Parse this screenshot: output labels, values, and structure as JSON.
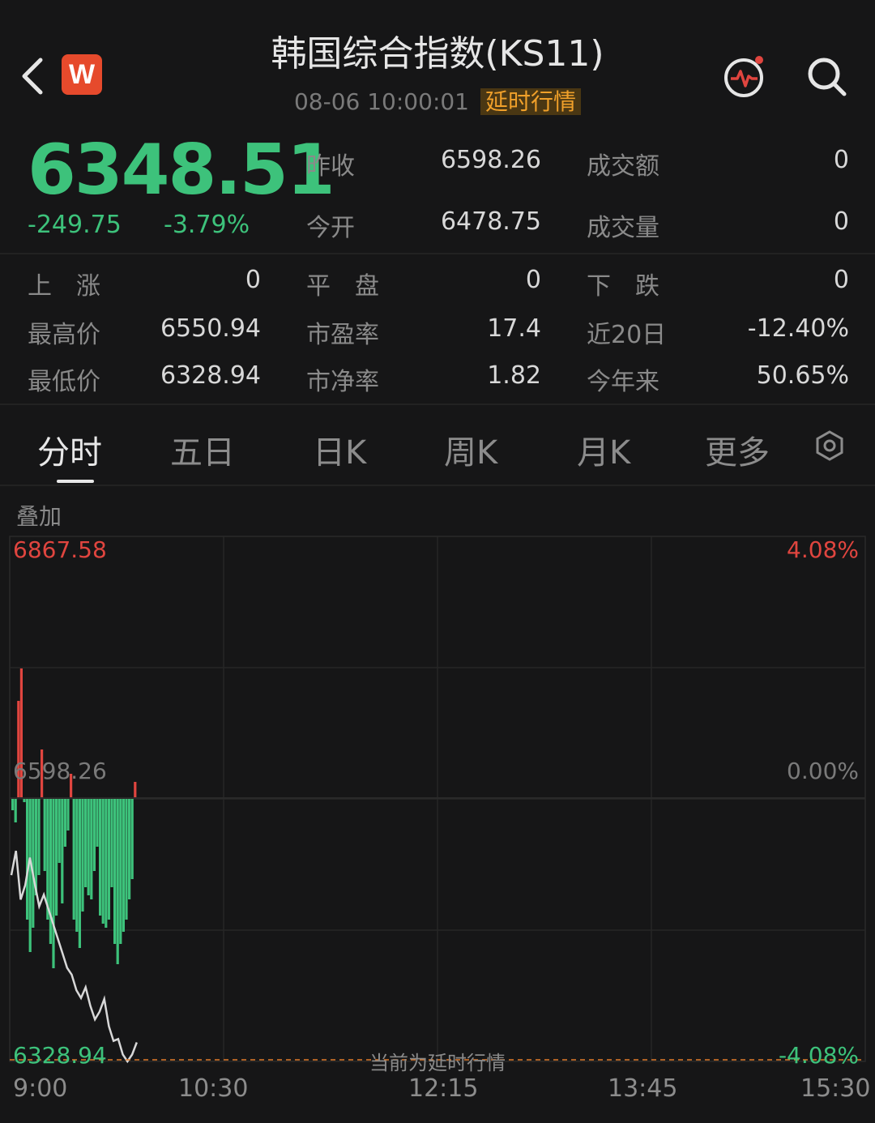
{
  "header": {
    "back_icon": "chevron-left-icon",
    "app_logo_text": "W",
    "title": "韩国综合指数(KS11)",
    "datetime": "08-06 10:00:01",
    "delay_badge": "延时行情",
    "pulse_icon": "pulse-alert-icon",
    "search_icon": "search-icon"
  },
  "quote": {
    "price": "6348.51",
    "change": "-249.75",
    "change_pct": "-3.79%",
    "fields": [
      {
        "label": "昨收",
        "value": "6598.26"
      },
      {
        "label": "成交额",
        "value": "0"
      },
      {
        "label": "今开",
        "value": "6478.75"
      },
      {
        "label": "成交量",
        "value": "0"
      }
    ]
  },
  "stats": [
    {
      "label": "上　涨",
      "value": "0"
    },
    {
      "label": "平　盘",
      "value": "0"
    },
    {
      "label": "下　跌",
      "value": "0"
    },
    {
      "label": "最高价",
      "value": "6550.94"
    },
    {
      "label": "市盈率",
      "value": "17.4"
    },
    {
      "label": "近20日",
      "value": "-12.40%"
    },
    {
      "label": "最低价",
      "value": "6328.94"
    },
    {
      "label": "市净率",
      "value": "1.82"
    },
    {
      "label": "今年来",
      "value": "50.65%"
    }
  ],
  "tabs": [
    "分时",
    "五日",
    "日K",
    "周K",
    "月K",
    "更多"
  ],
  "active_tab": "分时",
  "settings_icon": "hexagon-settings-icon",
  "overlay_label": "叠加",
  "colors": {
    "up": "#e0453f",
    "down": "#3dc27b",
    "accent": "#f0a02a"
  },
  "chart_data": {
    "type": "line",
    "y_left_labels": [
      "6867.58",
      "6598.26",
      "6328.94"
    ],
    "y_right_labels": [
      "4.08%",
      "0.00%",
      "-4.08%"
    ],
    "ylim": [
      6328.94,
      6867.58
    ],
    "prev_close": 6598.26,
    "x_tick_labels": [
      "9:00",
      "10:30",
      "12:15",
      "13:45",
      "15:30"
    ],
    "delay_notice": "当前为延时行情",
    "grid": true,
    "series": [
      {
        "values": [
          6520,
          6545,
          6495,
          6510,
          6538,
          6512,
          6488,
          6500,
          6485,
          6470,
          6455,
          6440,
          6425,
          6418,
          6402,
          6394,
          6405,
          6386,
          6372,
          6380,
          6393,
          6365,
          6350,
          6352,
          6336,
          6328.94,
          6336,
          6348.51
        ]
      }
    ],
    "bars": [
      -15,
      -30,
      120,
      160,
      -5,
      -150,
      -190,
      -160,
      -120,
      -95,
      60,
      -90,
      -150,
      -180,
      -210,
      -145,
      -80,
      -130,
      -60,
      -40,
      30,
      -150,
      -165,
      -185,
      -140,
      -110,
      -120,
      -125,
      -90,
      -60,
      -145,
      -155,
      -160,
      -150,
      -110,
      -180,
      -205,
      -180,
      -165,
      -150,
      -125,
      -100,
      20
    ]
  }
}
